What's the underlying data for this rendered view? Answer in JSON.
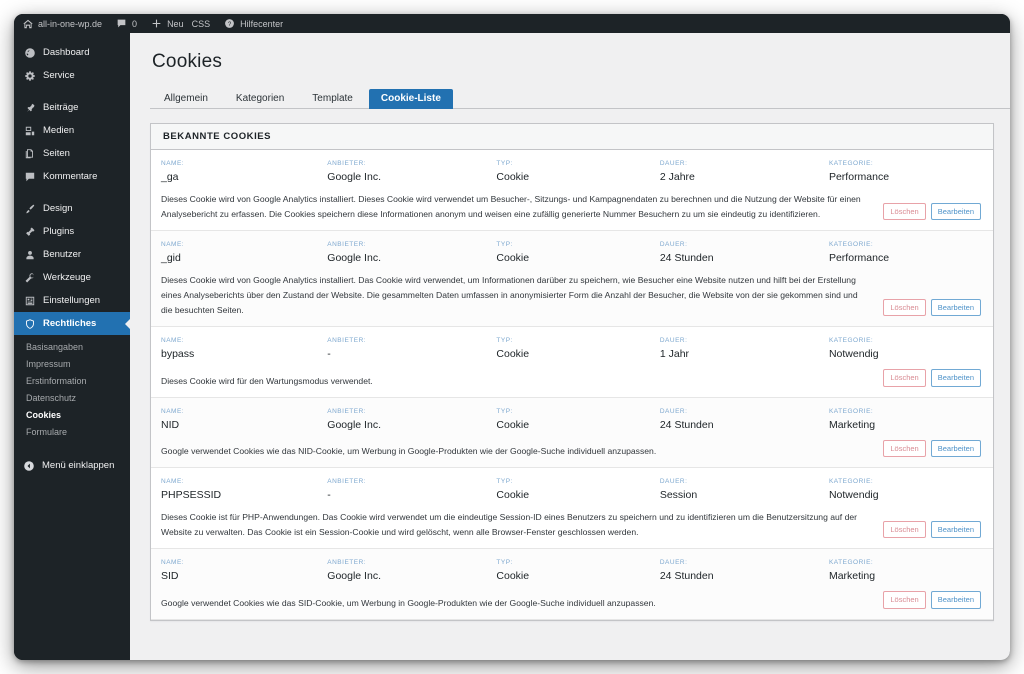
{
  "adminbar": {
    "site": "all-in-one-wp.de",
    "comments_count": "0",
    "new_label": "Neu",
    "css_label": "CSS",
    "help_label": "Hilfecenter"
  },
  "sidebar": {
    "items": [
      {
        "label": "Dashboard",
        "icon": "dashboard-icon",
        "active": false
      },
      {
        "label": "Service",
        "icon": "gear-icon",
        "active": false
      },
      {
        "label": "Beiträge",
        "icon": "pin-icon",
        "active": false
      },
      {
        "label": "Medien",
        "icon": "media-icon",
        "active": false
      },
      {
        "label": "Seiten",
        "icon": "pages-icon",
        "active": false
      },
      {
        "label": "Kommentare",
        "icon": "comment-icon",
        "active": false
      },
      {
        "label": "Design",
        "icon": "brush-icon",
        "active": false
      },
      {
        "label": "Plugins",
        "icon": "plugin-icon",
        "active": false
      },
      {
        "label": "Benutzer",
        "icon": "user-icon",
        "active": false
      },
      {
        "label": "Werkzeuge",
        "icon": "tools-icon",
        "active": false
      },
      {
        "label": "Einstellungen",
        "icon": "settings-icon",
        "active": false
      },
      {
        "label": "Rechtliches",
        "icon": "shield-icon",
        "active": true
      }
    ],
    "submenu": [
      {
        "label": "Basisangaben",
        "current": false
      },
      {
        "label": "Impressum",
        "current": false
      },
      {
        "label": "Erstinformation",
        "current": false
      },
      {
        "label": "Datenschutz",
        "current": false
      },
      {
        "label": "Cookies",
        "current": true
      },
      {
        "label": "Formulare",
        "current": false
      }
    ],
    "collapse_label": "Menü einklappen",
    "active_color": "#2271b1"
  },
  "page": {
    "title": "Cookies",
    "tabs": [
      {
        "label": "Allgemein",
        "active": false
      },
      {
        "label": "Kategorien",
        "active": false
      },
      {
        "label": "Template",
        "active": false
      },
      {
        "label": "Cookie-Liste",
        "active": true
      }
    ]
  },
  "panel": {
    "heading": "BEKANNTE COOKIES",
    "columns": {
      "name": "NAME:",
      "provider": "ANBIETER:",
      "type": "TYP:",
      "duration": "DAUER:",
      "category": "KATEGORIE:"
    },
    "buttons": {
      "delete": "Löschen",
      "edit": "Bearbeiten"
    },
    "rows": [
      {
        "name": "_ga",
        "provider": "Google Inc.",
        "type": "Cookie",
        "duration": "2 Jahre",
        "category": "Performance",
        "description": "Dieses Cookie wird von Google Analytics installiert. Dieses Cookie wird verwendet um Besucher-, Sitzungs- und Kampagnendaten zu berechnen und die Nutzung der Website für einen Analysebericht zu erfassen. Die Cookies speichern diese Informationen anonym und weisen eine zufällig generierte Nummer Besuchern zu um sie eindeutig zu identifizieren."
      },
      {
        "name": "_gid",
        "provider": "Google Inc.",
        "type": "Cookie",
        "duration": "24 Stunden",
        "category": "Performance",
        "description": "Dieses Cookie wird von Google Analytics installiert. Das Cookie wird verwendet, um Informationen darüber zu speichern, wie Besucher eine Website nutzen und hilft bei der Erstellung eines Analyseberichts über den Zustand der Website. Die gesammelten Daten umfassen in anonymisierter Form die Anzahl der Besucher, die Website von der sie gekommen sind und die besuchten Seiten."
      },
      {
        "name": "bypass",
        "provider": "-",
        "type": "Cookie",
        "duration": "1 Jahr",
        "category": "Notwendig",
        "description": "Dieses Cookie wird für den Wartungsmodus verwendet."
      },
      {
        "name": "NID",
        "provider": "Google Inc.",
        "type": "Cookie",
        "duration": "24 Stunden",
        "category": "Marketing",
        "description": "Google verwendet Cookies wie das NID-Cookie, um Werbung in Google-Produkten wie der Google-Suche individuell anzupassen."
      },
      {
        "name": "PHPSESSID",
        "provider": "-",
        "type": "Cookie",
        "duration": "Session",
        "category": "Notwendig",
        "description": "Dieses Cookie ist für PHP-Anwendungen. Das Cookie wird verwendet um die eindeutige Session-ID eines Benutzers zu speichern und zu identifizieren um die Benutzersitzung auf der Website zu verwalten. Das Cookie ist ein Session-Cookie und wird gelöscht, wenn alle Browser-Fenster geschlossen werden."
      },
      {
        "name": "SID",
        "provider": "Google Inc.",
        "type": "Cookie",
        "duration": "24 Stunden",
        "category": "Marketing",
        "description": "Google verwendet Cookies wie das SID-Cookie, um Werbung in Google-Produkten wie der Google-Suche individuell anzupassen."
      }
    ]
  }
}
